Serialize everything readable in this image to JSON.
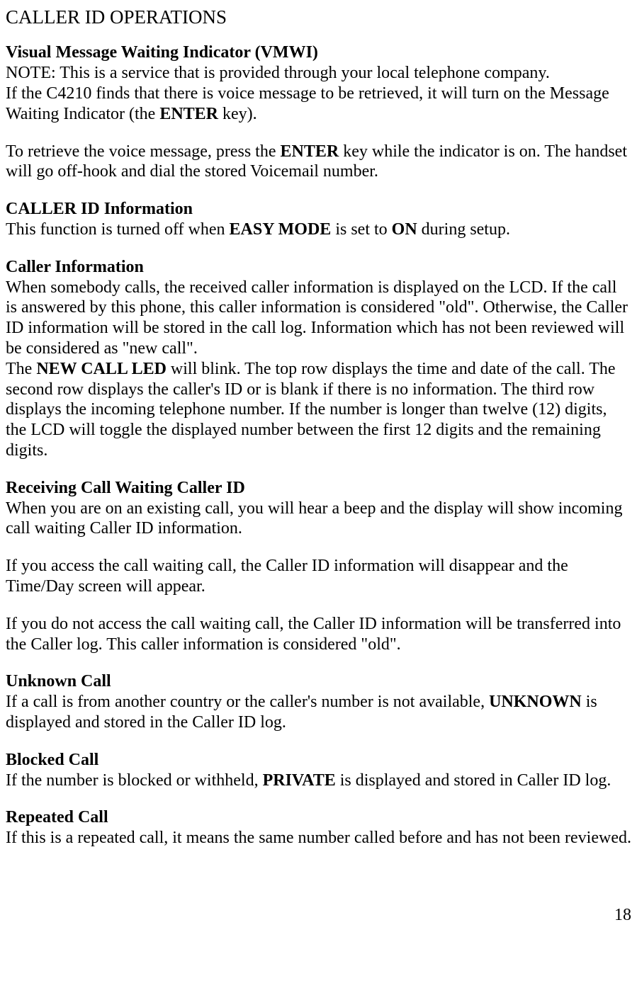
{
  "title": "CALLER ID OPERATIONS",
  "vmwi": {
    "heading": "Visual Message Waiting Indicator (VMWI)",
    "note": "NOTE: This is a service that is provided through your local telephone company.",
    "p1a": "If the C4210 finds that there is voice message to be retrieved, it will turn on the Message Waiting Indicator (the ",
    "enter": "ENTER",
    "p1b": " key).",
    "p2a": "To retrieve the voice message, press the ",
    "p2b": " key while the indicator is on. The handset will go off-hook and dial the stored Voicemail number."
  },
  "cidinfo": {
    "heading": "CALLER ID Information",
    "p1a": "This function is turned off when ",
    "easy": "EASY MODE",
    "p1b": " is set to ",
    "on": "ON",
    "p1c": " during setup."
  },
  "callerinfo": {
    "heading": "Caller Information",
    "p1": "When somebody calls, the received caller information is displayed on the LCD. If the call is answered by this phone, this caller information is considered \"old\". Otherwise, the Caller ID information will be stored in the call log. Information which has not been reviewed will be considered as \"new call\".",
    "p2a": "The ",
    "newcall": "NEW CALL LED",
    "p2b": " will blink. The top row displays the time and date of the call. The second row displays the caller's ID or is blank if there is no information. The third row displays the incoming telephone number. If the number is longer than twelve (12) digits, the LCD will toggle the displayed number between the first 12 digits and the remaining digits."
  },
  "rcw": {
    "heading": "Receiving Call Waiting Caller ID",
    "p1": "When you are on an existing call, you will hear a beep and the display will show incoming call waiting Caller ID information.",
    "p2": "If you access the call waiting call, the Caller ID information will disappear and the Time/Day screen will appear.",
    "p3": "If you do not access the call waiting call, the Caller ID information will be transferred into the Caller log. This caller information is considered \"old\"."
  },
  "unknown": {
    "heading": "Unknown Call",
    "p1a": "If a call is from another country or the caller's number is not available, ",
    "label": "UNKNOWN",
    "p1b": " is displayed and stored in the Caller ID log."
  },
  "blocked": {
    "heading": "Blocked Call",
    "p1a": "If the number is blocked or withheld, ",
    "label": "PRIVATE",
    "p1b": " is displayed and stored in Caller ID log."
  },
  "repeated": {
    "heading": "Repeated Call",
    "p1": "If this is a repeated call, it means the same number called before and has not been reviewed."
  },
  "pageNumber": "18"
}
